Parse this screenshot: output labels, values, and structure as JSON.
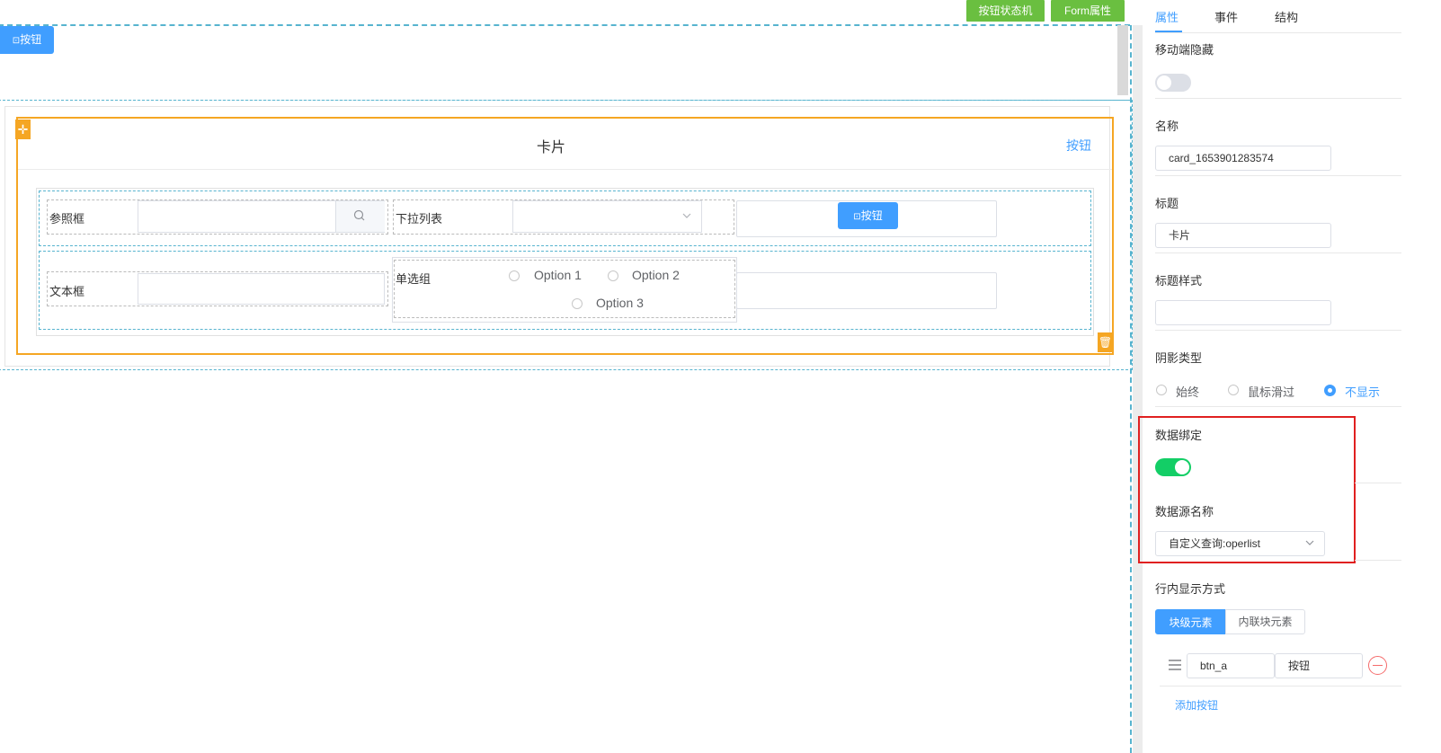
{
  "toolbar": {
    "state_machine": "按钮状态机",
    "form_props": "Form属性"
  },
  "canvas": {
    "top_button": "按钮",
    "card": {
      "title": "卡片",
      "header_button": "按钮",
      "ref_label": "参照框",
      "dropdown_label": "下拉列表",
      "action_button": "按钮",
      "textbox_label": "文本框",
      "radio_label": "单选组",
      "options": [
        "Option 1",
        "Option 2",
        "Option 3"
      ]
    }
  },
  "panel": {
    "tabs": [
      "属性",
      "事件",
      "结构"
    ],
    "mobile_hidden": {
      "label": "移动端隐藏",
      "on": false
    },
    "name": {
      "label": "名称",
      "value": "card_1653901283574"
    },
    "title": {
      "label": "标题",
      "value": "卡片"
    },
    "title_style": {
      "label": "标题样式",
      "value": ""
    },
    "shadow": {
      "label": "阴影类型",
      "options": [
        "始终",
        "鼠标滑过",
        "不显示"
      ],
      "selected": "不显示"
    },
    "data_binding": {
      "label": "数据绑定",
      "on": true
    },
    "datasource": {
      "label": "数据源名称",
      "value": "自定义查询:operlist"
    },
    "inline_display": {
      "label": "行内显示方式",
      "options": [
        "块级元素",
        "内联块元素"
      ],
      "selected": "块级元素"
    },
    "button_row": {
      "key": "btn_a",
      "text": "按钮"
    },
    "add_button": "添加按钮"
  },
  "colors": {
    "accent": "#409eff",
    "green": "#6abf40",
    "toggle_on": "#13ce66",
    "orange": "#f5a623",
    "highlight": "#e02020"
  }
}
